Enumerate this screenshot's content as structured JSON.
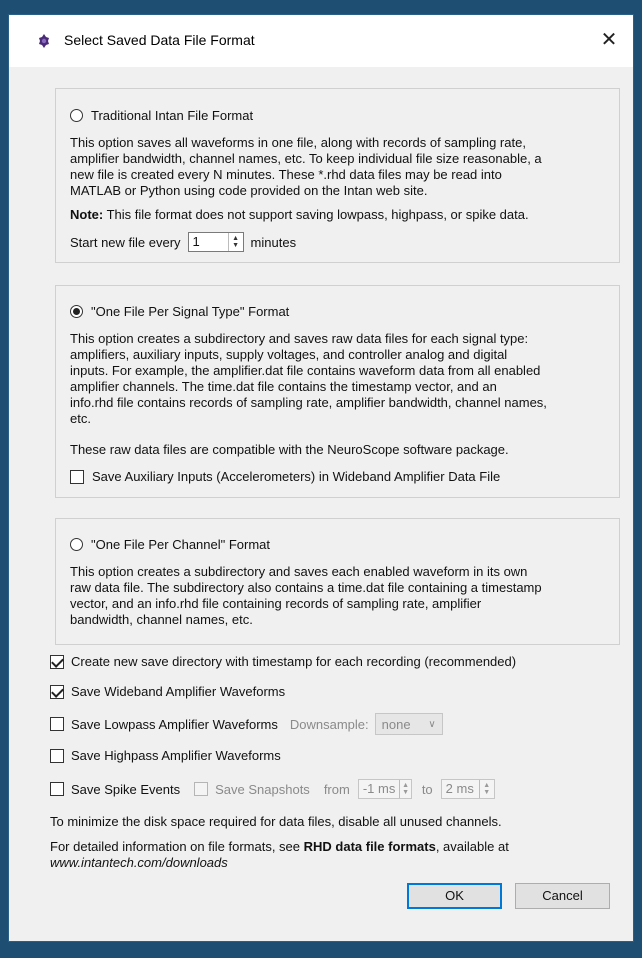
{
  "window": {
    "title": "Select Saved Data File Format",
    "close_glyph": "✕"
  },
  "traditional": {
    "label": "Traditional Intan File Format",
    "selected": false,
    "desc_lines": [
      "This option saves all waveforms in one file, along with records of sampling rate,",
      "amplifier bandwidth, channel names, etc.  To keep individual file size reasonable, a",
      "new file is created every N minutes.  These *.rhd data files may be read into",
      "MATLAB or Python using code provided on the Intan web site."
    ],
    "note_label": "Note:",
    "note_text": " This file format does not support saving lowpass, highpass, or spike data.",
    "start_label": "Start new file every",
    "minutes_value": "1",
    "minutes_unit": "minutes"
  },
  "per_signal": {
    "label": "\"One File Per Signal Type\" Format",
    "selected": true,
    "desc_lines": [
      "This option creates a subdirectory and saves raw data files for each signal type:",
      "amplifiers, auxiliary inputs, supply voltages, and controller analog and digital",
      "inputs. For example, the amplifier.dat file contains waveform data from all enabled",
      "amplifier channels.  The time.dat file contains the timestamp vector, and an",
      "info.rhd file contains records of sampling rate, amplifier bandwidth, channel names,",
      "etc."
    ],
    "compat_text": "These raw data files are compatible with the NeuroScope software package.",
    "aux_label": "Save Auxiliary Inputs (Accelerometers) in Wideband Amplifier Data File",
    "aux_checked": false
  },
  "per_channel": {
    "label": "\"One File Per Channel\" Format",
    "selected": false,
    "desc_lines": [
      "This option creates a subdirectory and saves each enabled waveform in its own",
      "raw data file.  The subdirectory also contains a time.dat file containing a timestamp",
      "vector, and an info.rhd file containing records of sampling rate, amplifier",
      "bandwidth, channel names, etc."
    ]
  },
  "options": {
    "create_dir_label": "Create new save directory with timestamp for each recording (recommended)",
    "create_dir_checked": true,
    "wideband_label": "Save Wideband Amplifier Waveforms",
    "wideband_checked": true,
    "lowpass_label": "Save Lowpass Amplifier Waveforms",
    "lowpass_checked": false,
    "downsample_label": "Downsample:",
    "downsample_value": "none",
    "highpass_label": "Save Highpass Amplifier Waveforms",
    "highpass_checked": false,
    "spike_label": "Save Spike Events",
    "spike_checked": false,
    "snapshots_label": "Save Snapshots",
    "from_label": "from",
    "from_value": "-1 ms",
    "to_label": "to",
    "to_value": "2 ms"
  },
  "footer": {
    "minimize_text": "To minimize the disk space required for data files, disable all unused channels.",
    "detail_prefix": "For detailed information on file formats, see ",
    "detail_link": "RHD data file formats",
    "detail_suffix": ", available at",
    "url": "www.intantech.com/downloads"
  },
  "buttons": {
    "ok": "OK",
    "cancel": "Cancel"
  },
  "colors": {
    "window_border": "#1e4f73",
    "dialog_bg": "#f0f0f0",
    "default_button": "#0078d7",
    "title_icon": "#4b2a78"
  },
  "icons": {
    "title": "intan-logo-icon",
    "close": "close-icon"
  }
}
